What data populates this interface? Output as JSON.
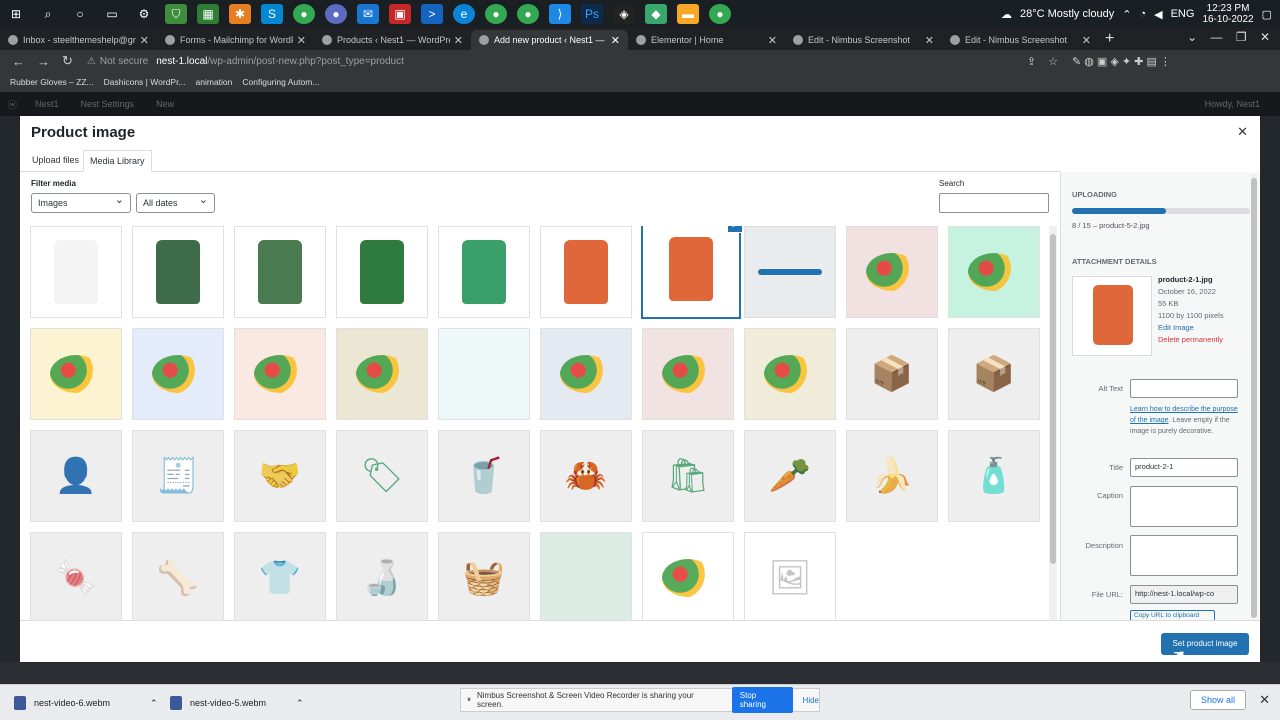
{
  "taskbar": {
    "weather": "28°C  Mostly cloudy",
    "lang": "ENG",
    "time": "12:23 PM",
    "date": "16-10-2022"
  },
  "browser": {
    "tabs": [
      {
        "title": "Inbox - steelthemeshelp@gmail"
      },
      {
        "title": "Forms - Mailchimp for WordPre"
      },
      {
        "title": "Products ‹ Nest1 — WordPress"
      },
      {
        "title": "Add new product ‹ Nest1 — Wo",
        "active": true
      },
      {
        "title": "Elementor | Home"
      },
      {
        "title": "Edit - Nimbus Screenshot"
      },
      {
        "title": "Edit - Nimbus Screenshot"
      }
    ],
    "not_secure": "Not secure",
    "url_host": "nest-1.local",
    "url_path": "/wp-admin/post-new.php?post_type=product",
    "bookmarks": [
      "Rubber Gloves – ZZ...",
      "Dashicons | WordPr...",
      "animation",
      "Configuring Autom..."
    ]
  },
  "wp_admin_bar": {
    "site": "Nest1",
    "settings": "Nest Settings",
    "new": "New",
    "howdy": "Howdy, Nest1"
  },
  "modal": {
    "title": "Product image",
    "tabs": [
      "Upload files",
      "Media Library"
    ],
    "active_tab": "Media Library",
    "filter_label": "Filter media",
    "filter_type": "Images",
    "filter_date": "All dates",
    "search_label": "Search",
    "grid": [
      {
        "kind": "bag",
        "color": "#f4f4f4",
        "icon": "coconut-bag-icon"
      },
      {
        "kind": "bag",
        "color": "#3e6b48",
        "icon": "green-bag-icon"
      },
      {
        "kind": "bag",
        "color": "#4a7a50",
        "icon": "bean-bag-icon"
      },
      {
        "kind": "bag",
        "color": "#2f7a3e",
        "icon": "green-bag-back-icon"
      },
      {
        "kind": "bag",
        "color": "#3aa06a",
        "icon": "veggie-pops-bag-icon"
      },
      {
        "kind": "bag",
        "color": "#e0673a",
        "icon": "orange-bag-back-icon"
      },
      {
        "kind": "bag",
        "color": "#e0673a",
        "icon": "sahale-bag-icon",
        "selected": true
      },
      {
        "kind": "bar",
        "color": "#e9ecef",
        "icon": "blue-bar-icon"
      },
      {
        "kind": "photo",
        "color": "#f2e1e1",
        "icon": "vegetable-basket-icon"
      },
      {
        "kind": "photo",
        "color": "#c6f3df",
        "icon": "vegetables-icon"
      },
      {
        "kind": "photo",
        "color": "#fbf3d1",
        "icon": "fruits-icon"
      },
      {
        "kind": "photo",
        "color": "#e4ebfa",
        "icon": "shopping-basket-icon"
      },
      {
        "kind": "photo",
        "color": "#f9e9e0",
        "icon": "vegetables-pile-icon"
      },
      {
        "kind": "photo",
        "color": "#ece6d4",
        "icon": "juice-glass-icon"
      },
      {
        "kind": "photo",
        "color": "#eef8f8",
        "icon": "blank-mint-icon"
      },
      {
        "kind": "photo",
        "color": "#e5e9f1",
        "icon": "greens-icon"
      },
      {
        "kind": "photo",
        "color": "#f2e3e3",
        "icon": "strawberry-bottle-icon"
      },
      {
        "kind": "photo",
        "color": "#f1ecd9",
        "icon": "onion-icon"
      },
      {
        "kind": "icon",
        "color": "#eeeeee",
        "icon": "delivery-box-icon",
        "glyph": "📦"
      },
      {
        "kind": "icon",
        "color": "#eeeeee",
        "icon": "return-box-icon",
        "glyph": "📦"
      },
      {
        "kind": "icon",
        "color": "#eeeeee",
        "icon": "org-chart-icon",
        "glyph": "👤"
      },
      {
        "kind": "icon",
        "color": "#eeeeee",
        "icon": "invoice-dollar-icon",
        "glyph": "🧾"
      },
      {
        "kind": "icon",
        "color": "#eeeeee",
        "icon": "handshake-coin-icon",
        "glyph": "🤝"
      },
      {
        "kind": "icon",
        "color": "#eeeeee",
        "icon": "price-tag-icon",
        "glyph": "🏷"
      },
      {
        "kind": "icon",
        "color": "#eeeeee",
        "icon": "juice-jug-icon",
        "glyph": "🥤"
      },
      {
        "kind": "icon",
        "color": "#eeeeee",
        "icon": "crab-icon",
        "glyph": "🦀"
      },
      {
        "kind": "icon",
        "color": "#eeeeee",
        "icon": "grocery-bag-icon",
        "glyph": "🛍"
      },
      {
        "kind": "icon",
        "color": "#eeeeee",
        "icon": "vegetables-line-icon",
        "glyph": "🥕"
      },
      {
        "kind": "icon",
        "color": "#eeeeee",
        "icon": "apple-banana-icon",
        "glyph": "🍌"
      },
      {
        "kind": "icon",
        "color": "#eeeeee",
        "icon": "detergent-icon",
        "glyph": "🧴"
      },
      {
        "kind": "icon",
        "color": "#eeeeee",
        "icon": "snack-bag-icon",
        "glyph": "🍬"
      },
      {
        "kind": "icon",
        "color": "#eeeeee",
        "icon": "pet-food-icon",
        "glyph": "🦴"
      },
      {
        "kind": "icon",
        "color": "#eeeeee",
        "icon": "baby-clothes-icon",
        "glyph": "👕"
      },
      {
        "kind": "icon",
        "color": "#eeeeee",
        "icon": "bottles-icon",
        "glyph": "🍶"
      },
      {
        "kind": "icon",
        "color": "#eeeeee",
        "icon": "basket-icon",
        "glyph": "🧺"
      },
      {
        "kind": "photo",
        "color": "#dcebe3",
        "icon": "mint-banner-icon"
      },
      {
        "kind": "photo",
        "color": "#ffffff",
        "icon": "groceries-photo-icon"
      },
      {
        "kind": "placeholder",
        "color": "#ffffff",
        "icon": "image-placeholder-icon",
        "glyph": "🖼"
      }
    ]
  },
  "sidebar": {
    "uploading_label": "UPLOADING",
    "progress": 0.53,
    "progress_text": "8 / 15  –  product-5-2.jpg",
    "details_label": "ATTACHMENT DETAILS",
    "filename": "product-2-1.jpg",
    "date": "October 16, 2022",
    "size": "55 KB",
    "dimensions": "1100 by 1100 pixels",
    "edit_image": "Edit Image",
    "delete": "Delete permanently",
    "alt_label": "Alt Text",
    "alt_value": "",
    "alt_help_link": "Learn how to describe the purpose of the image",
    "alt_help_rest": ". Leave empty if the image is purely decorative.",
    "title_label": "Title",
    "title_value": "product-2-1",
    "caption_label": "Caption",
    "description_label": "Description",
    "fileurl_label": "File URL:",
    "fileurl_value": "http://nest-1.local/wp-co",
    "copy_btn": "Copy URL to clipboard"
  },
  "footer": {
    "set_button": "Set product image"
  },
  "downloads": {
    "items": [
      "nest-video-6.webm",
      "nest-video-5.webm"
    ],
    "share_text": "Nimbus Screenshot & Screen Video Recorder is sharing your screen.",
    "stop": "Stop sharing",
    "hide": "Hide",
    "show_all": "Show all"
  }
}
